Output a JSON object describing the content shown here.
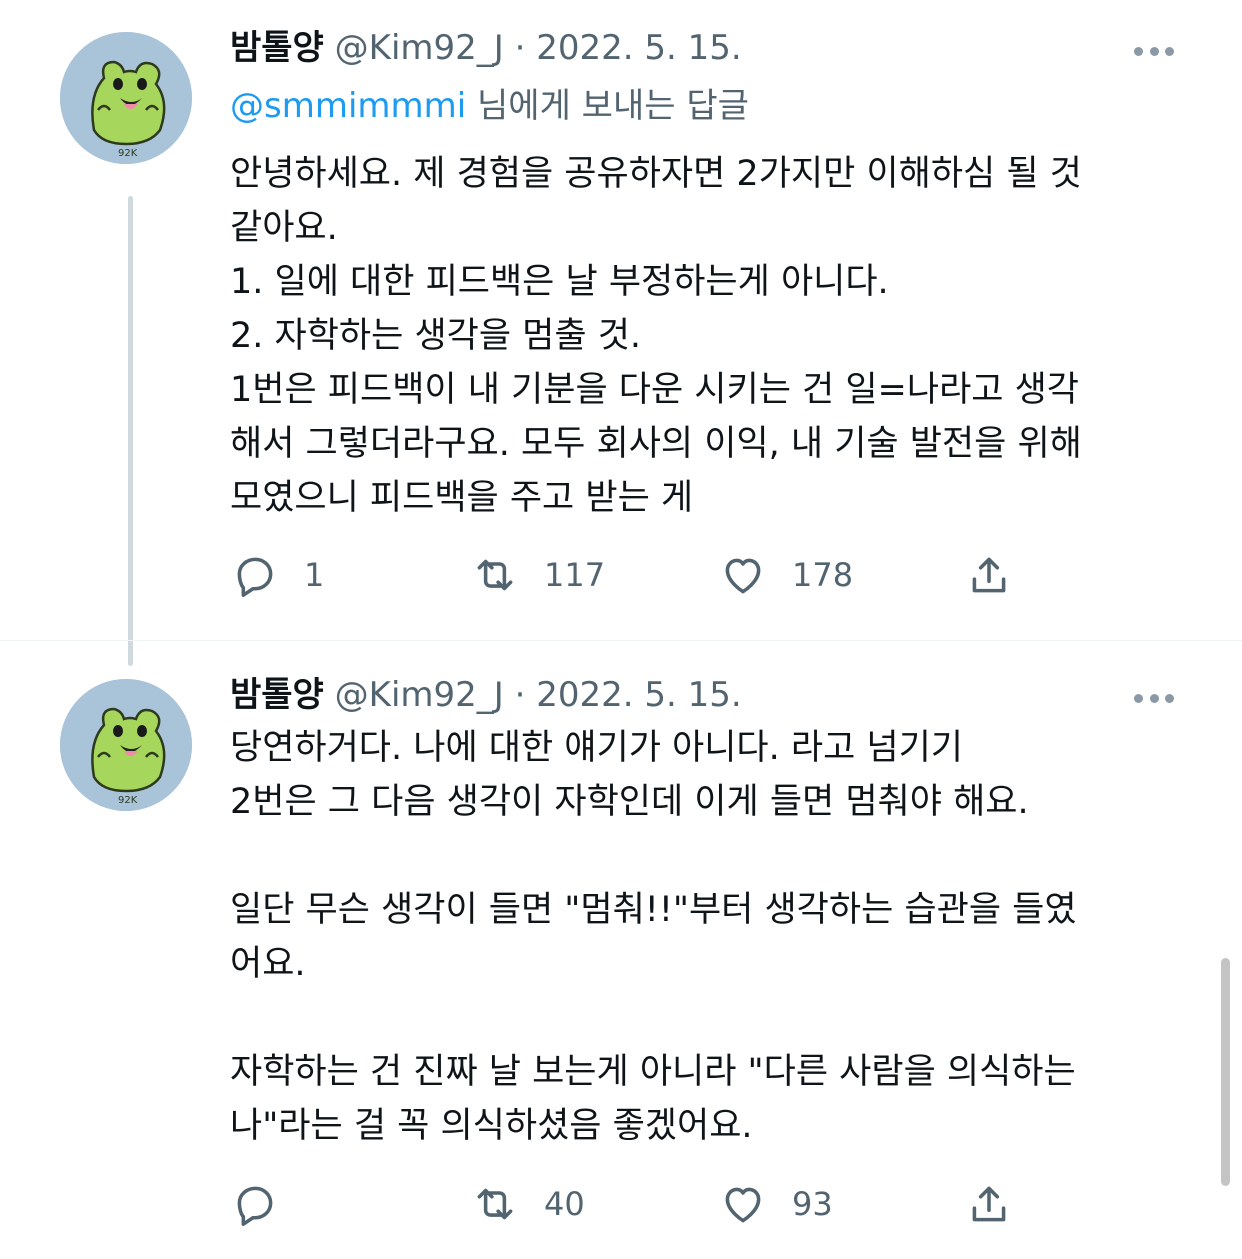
{
  "colors": {
    "text": "#0f1419",
    "secondary": "#536471",
    "link": "#1d9bf0",
    "avatar_bg": "#a9c3d9",
    "avatar_frog": "#a6d65c"
  },
  "icons": {
    "reply": "speech-bubble",
    "retweet": "retweet-arrows",
    "like": "heart",
    "share": "share-arrow-up",
    "more": "three-dots"
  },
  "tweets": [
    {
      "display_name": "밤톨양",
      "handle": "@Kim92_J",
      "separator": "·",
      "date": "2022. 5. 15.",
      "avatar_text": "92K",
      "reply_to": {
        "mention": "@smmimmmi",
        "suffix": " 님에게 보내는 답글"
      },
      "lines": [
        "안녕하세요. 제 경험을 공유하자면 2가지만 이해하심 될 것",
        "같아요.",
        "1. 일에 대한 피드백은 날 부정하는게 아니다.",
        "2. 자학하는 생각을 멈출 것.",
        "1번은 피드백이 내 기분을 다운 시키는 건 일=나라고 생각",
        "해서 그렇더라구요. 모두 회사의 이익, 내 기술 발전을 위해",
        "모였으니 피드백을 주고 받는 게"
      ],
      "counts": {
        "reply": "1",
        "retweet": "117",
        "like": "178"
      }
    },
    {
      "display_name": "밤톨양",
      "handle": "@Kim92_J",
      "separator": "·",
      "date": "2022. 5. 15.",
      "avatar_text": "92K",
      "lines": [
        "당연하거다. 나에 대한 얘기가 아니다. 라고 넘기기",
        "2번은 그 다음 생각이 자학인데 이게 들면 멈춰야 해요.",
        "",
        "일단 무슨 생각이 들면 \"멈춰!!\"부터 생각하는 습관을 들였",
        "어요.",
        "",
        "자학하는 건 진짜 날 보는게 아니라 \"다른 사람을 의식하는",
        "나\"라는 걸 꼭 의식하셨음 좋겠어요."
      ],
      "counts": {
        "reply": "",
        "retweet": "40",
        "like": "93"
      }
    }
  ]
}
